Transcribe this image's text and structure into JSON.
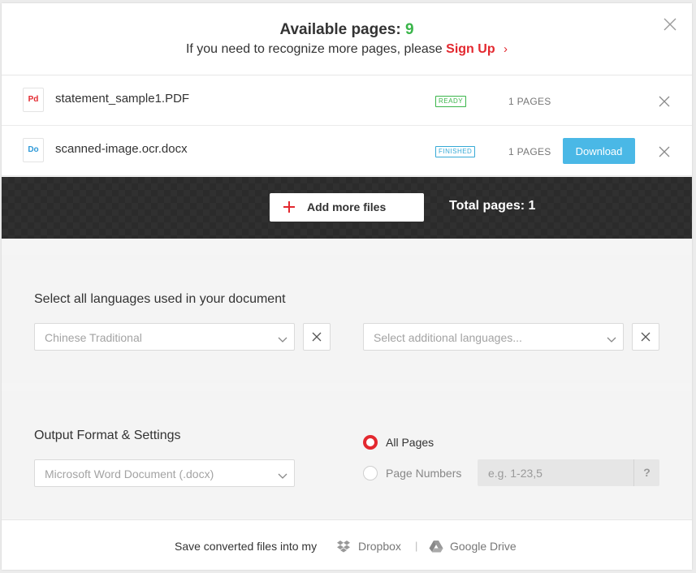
{
  "header": {
    "available_label": "Available pages:",
    "available_count": "9",
    "need_more_text": "If you need to recognize more pages, please",
    "signup_label": "Sign Up",
    "close_icon": "close-icon"
  },
  "files": [
    {
      "type_label": "Pd",
      "name": "statement_sample1.PDF",
      "status": "READY",
      "pages": "1 PAGES"
    },
    {
      "type_label": "Do",
      "name": "scanned-image.ocr.docx",
      "status": "FINISHED",
      "pages": "1 PAGES",
      "download_label": "Download"
    }
  ],
  "toolbar": {
    "add_files_label": "Add more files",
    "total_pages": "Total pages: 1"
  },
  "languages": {
    "title": "Select all languages used in your document",
    "primary_value": "Chinese Traditional",
    "additional_placeholder": "Select additional languages..."
  },
  "output": {
    "title": "Output Format & Settings",
    "format_value": "Microsoft Word Document (.docx)",
    "all_pages_label": "All Pages",
    "page_numbers_label": "Page Numbers",
    "page_numbers_placeholder": "e.g. 1-23,5",
    "help_label": "?"
  },
  "footer": {
    "save_text": "Save converted files into my",
    "dropbox_label": "Dropbox",
    "separator": "|",
    "gdrive_label": "Google Drive"
  },
  "colors": {
    "accent_red": "#e3282f",
    "green": "#3ab54a",
    "blue": "#4ab8e6",
    "dark_bar": "#303030"
  }
}
